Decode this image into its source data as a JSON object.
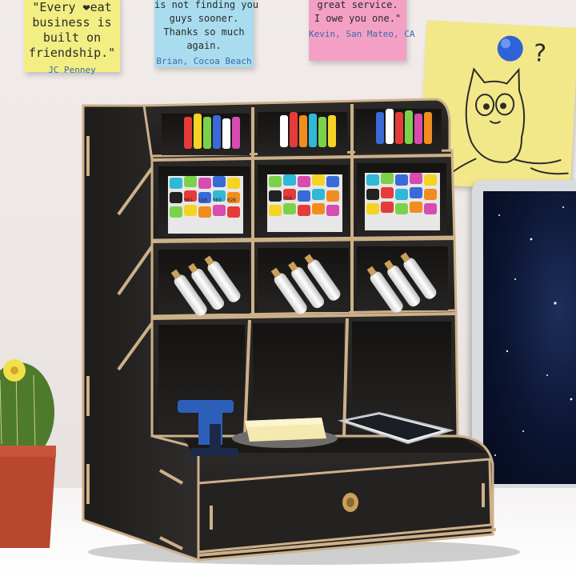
{
  "scene": {
    "notes": [
      {
        "lines": [
          "\"Every ❤eat",
          "business is",
          "built on",
          "friendship.\""
        ],
        "signature": "JC Penney",
        "color": "#f2ee83"
      },
      {
        "lines": [
          "is not finding you",
          "guys sooner.",
          "Thanks so much",
          "again."
        ],
        "signature": "Brian, Cocoa Beach",
        "color": "#a9dcee"
      },
      {
        "lines": [
          "great service.",
          "I owe you one.\""
        ],
        "signature": "Kevin, San Mateo, CA",
        "color": "#f4a0c4"
      },
      {
        "doodle": "cat-doodle",
        "text": "?",
        "color": "#f3e889"
      }
    ],
    "organizer": {
      "color": "#2a2826",
      "edge_color": "#cdb08a",
      "marker_labels": [
        "001",
        "110",
        "069",
        "028",
        "050"
      ],
      "marker_colors": [
        "#e63b3b",
        "#f28c1e",
        "#f5d323",
        "#7bd24a",
        "#2fb8d8",
        "#3a6ad8",
        "#d84bb0",
        "#ffffff",
        "#222222"
      ]
    },
    "laptop": {
      "screen_color": "#0b1430"
    },
    "cactus": {
      "pot_color": "#b9462e",
      "flower_color": "#f0e14a"
    }
  }
}
